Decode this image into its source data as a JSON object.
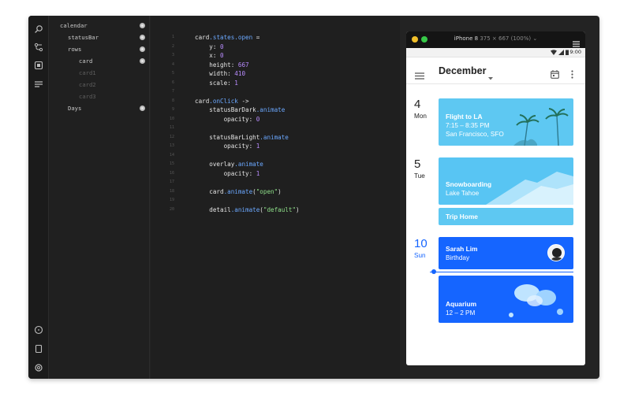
{
  "layers": [
    {
      "label": "calendar",
      "dim": false
    },
    {
      "label": "statusBar",
      "dim": false
    },
    {
      "label": "rows",
      "dim": false
    },
    {
      "label": "card",
      "dim": false
    },
    {
      "label": "card1",
      "dim": true
    },
    {
      "label": "card2",
      "dim": true
    },
    {
      "label": "card3",
      "dim": true
    },
    {
      "label": "Days",
      "dim": false
    }
  ],
  "code": [
    {
      "n": "1",
      "tokens": [
        {
          "t": "card",
          "c": "plain"
        },
        {
          "t": ".states.open",
          "c": "prop"
        },
        {
          "t": " =",
          "c": "plain"
        }
      ]
    },
    {
      "n": "2",
      "tokens": [
        {
          "t": "    y: ",
          "c": "plain"
        },
        {
          "t": "0",
          "c": "num"
        }
      ]
    },
    {
      "n": "3",
      "tokens": [
        {
          "t": "    x: ",
          "c": "plain"
        },
        {
          "t": "0",
          "c": "num"
        }
      ]
    },
    {
      "n": "4",
      "tokens": [
        {
          "t": "    height: ",
          "c": "plain"
        },
        {
          "t": "667",
          "c": "num"
        }
      ]
    },
    {
      "n": "5",
      "tokens": [
        {
          "t": "    width: ",
          "c": "plain"
        },
        {
          "t": "410",
          "c": "num"
        }
      ]
    },
    {
      "n": "6",
      "tokens": [
        {
          "t": "    scale: ",
          "c": "plain"
        },
        {
          "t": "1",
          "c": "num"
        }
      ]
    },
    {
      "n": "7",
      "tokens": []
    },
    {
      "n": "8",
      "tokens": [
        {
          "t": "card",
          "c": "plain"
        },
        {
          "t": ".onClick",
          "c": "prop"
        },
        {
          "t": " ->",
          "c": "plain"
        }
      ]
    },
    {
      "n": "9",
      "tokens": [
        {
          "t": "    statusBarDark",
          "c": "plain"
        },
        {
          "t": ".animate",
          "c": "prop"
        }
      ]
    },
    {
      "n": "10",
      "tokens": [
        {
          "t": "        opacity: ",
          "c": "plain"
        },
        {
          "t": "0",
          "c": "num"
        }
      ]
    },
    {
      "n": "11",
      "tokens": []
    },
    {
      "n": "12",
      "tokens": [
        {
          "t": "    statusBarLight",
          "c": "plain"
        },
        {
          "t": ".animate",
          "c": "prop"
        }
      ]
    },
    {
      "n": "13",
      "tokens": [
        {
          "t": "        opacity: ",
          "c": "plain"
        },
        {
          "t": "1",
          "c": "num"
        }
      ]
    },
    {
      "n": "14",
      "tokens": []
    },
    {
      "n": "15",
      "tokens": [
        {
          "t": "    overlay",
          "c": "plain"
        },
        {
          "t": ".animate",
          "c": "prop"
        }
      ]
    },
    {
      "n": "16",
      "tokens": [
        {
          "t": "        opacity: ",
          "c": "plain"
        },
        {
          "t": "1",
          "c": "num"
        }
      ]
    },
    {
      "n": "17",
      "tokens": []
    },
    {
      "n": "18",
      "tokens": [
        {
          "t": "    card",
          "c": "plain"
        },
        {
          "t": ".animate",
          "c": "prop"
        },
        {
          "t": "(",
          "c": "plain"
        },
        {
          "t": "\"open\"",
          "c": "str"
        },
        {
          "t": ")",
          "c": "plain"
        }
      ]
    },
    {
      "n": "19",
      "tokens": []
    },
    {
      "n": "20",
      "tokens": [
        {
          "t": "    detail",
          "c": "plain"
        },
        {
          "t": ".animate",
          "c": "prop"
        },
        {
          "t": "(",
          "c": "plain"
        },
        {
          "t": "\"default\"",
          "c": "str"
        },
        {
          "t": ")",
          "c": "plain"
        }
      ]
    }
  ],
  "preview": {
    "device": "iPhone 8",
    "device_detail": "375 × 667 (100%)",
    "time": "9:00",
    "month": "December",
    "days": [
      {
        "num": "4",
        "name": "Mon"
      },
      {
        "num": "5",
        "name": "Tue"
      },
      {
        "num": "10",
        "name": "Sun"
      }
    ],
    "events": {
      "flight": {
        "title": "Flight to LA",
        "time": "7:15 – 8:35 PM",
        "place": "San Francisco, SFO"
      },
      "snow": {
        "title": "Snowboarding",
        "place": "Lake Tahoe"
      },
      "trip": {
        "title": "Trip Home"
      },
      "sarah": {
        "title": "Sarah Lim",
        "sub": "Birthday"
      },
      "aquarium": {
        "title": "Aquarium",
        "time": "12 – 2 PM"
      }
    }
  },
  "colors": {
    "accent": "#1565ff",
    "sky": "#5ec8f2",
    "today": "#1565ff"
  }
}
